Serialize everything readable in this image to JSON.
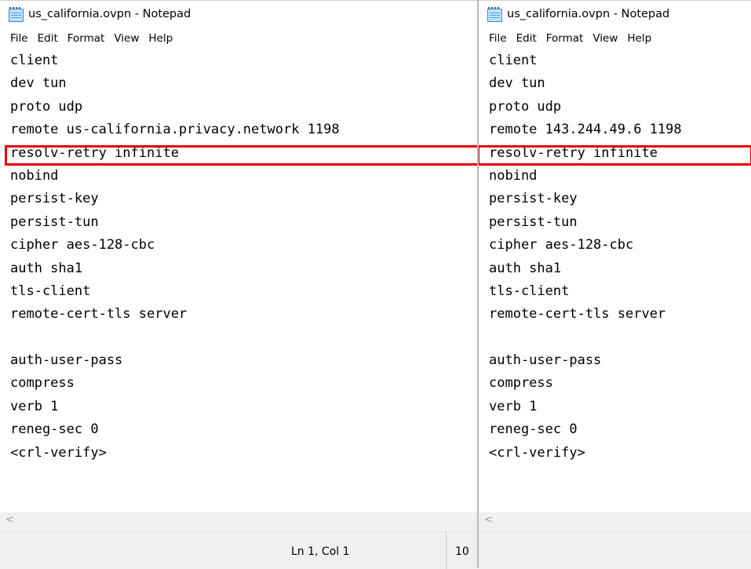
{
  "left_window": {
    "title": "us_california.ovpn - Notepad",
    "menu": [
      "File",
      "Edit",
      "Format",
      "View",
      "Help"
    ],
    "lines": [
      "client",
      "dev tun",
      "proto udp",
      "remote us-california.privacy.network 1198",
      "resolv-retry infinite",
      "nobind",
      "persist-key",
      "persist-tun",
      "cipher aes-128-cbc",
      "auth sha1",
      "tls-client",
      "remote-cert-tls server",
      "",
      "auth-user-pass",
      "compress",
      "verb 1",
      "reneg-sec 0",
      "<crl-verify>"
    ],
    "status_position": "Ln 1, Col 1",
    "status_zoom": "10",
    "scroll_left_arrow": "<"
  },
  "right_window": {
    "title": "us_california.ovpn - Notepad",
    "menu": [
      "File",
      "Edit",
      "Format",
      "View",
      "Help"
    ],
    "lines": [
      "client",
      "dev tun",
      "proto udp",
      "remote 143.244.49.6 1198",
      "resolv-retry infinite",
      "nobind",
      "persist-key",
      "persist-tun",
      "cipher aes-128-cbc",
      "auth sha1",
      "tls-client",
      "remote-cert-tls server",
      "",
      "auth-user-pass",
      "compress",
      "verb 1",
      "reneg-sec 0",
      "<crl-verify>"
    ],
    "scroll_left_arrow": "<"
  },
  "highlight_color": "#e10000"
}
